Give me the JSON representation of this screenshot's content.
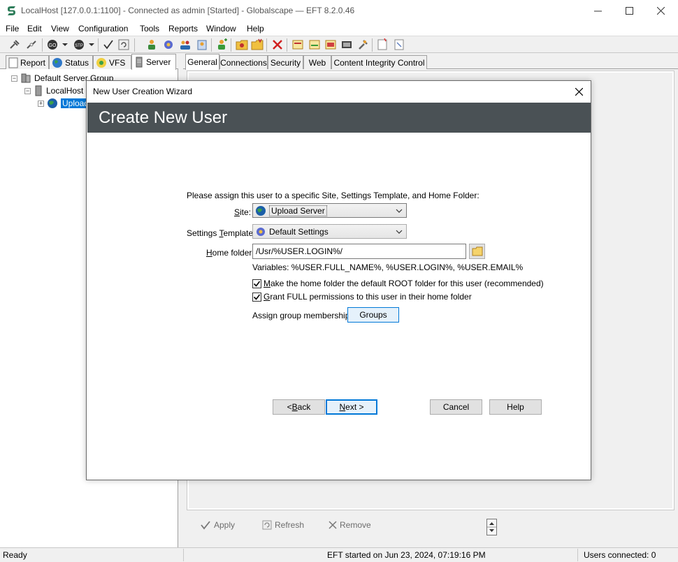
{
  "window": {
    "title": "LocalHost [127.0.0.1:1100] - Connected as admin [Started] - Globalscape — EFT 8.2.0.46"
  },
  "menu": [
    "File",
    "Edit",
    "View",
    "Configuration",
    "Tools",
    "Reports",
    "Window",
    "Help"
  ],
  "left_tabs": [
    "Report",
    "Status",
    "VFS",
    "Server"
  ],
  "tree": {
    "root": "Default Server Group",
    "server": "LocalHost",
    "site": "Upload"
  },
  "right_tabs": [
    "General",
    "Connections",
    "Security",
    "Web",
    "Content Integrity Control"
  ],
  "bottom_actions": {
    "apply": "Apply",
    "refresh": "Refresh",
    "remove": "Remove"
  },
  "status": {
    "ready": "Ready",
    "started": "EFT started on Jun 23, 2024, 07:19:16 PM",
    "users": "Users connected: 0"
  },
  "dialog": {
    "title": "New User Creation Wizard",
    "heading": "Create New User",
    "instruction": "Please assign this user to a specific Site, Settings Template, and Home Folder:",
    "site_label_key": "S",
    "site_label_rest": "ite:",
    "site_value": "Upload Server",
    "template_label_pre": "Settings ",
    "template_label_key": "T",
    "template_label_rest": "emplate:",
    "template_value": "Default Settings",
    "home_label_key": "H",
    "home_label_rest": "ome folder:",
    "home_value": "/Usr/%USER.LOGIN%/",
    "variables": "Variables: %USER.FULL_NAME%, %USER.LOGIN%, %USER.EMAIL%",
    "root_check_key": "M",
    "root_check_rest": "ake the home folder the default ROOT folder for this user (recommended)",
    "grant_check_key": "G",
    "grant_check_rest": "rant FULL permissions to this user in their home folder",
    "group_label": "Assign group membership:",
    "groups_button": "Groups",
    "back_pre": "< ",
    "back_key": "B",
    "back_rest": "ack",
    "next_key": "N",
    "next_rest": "ext >",
    "cancel_button": "Cancel",
    "help_button": "Help"
  }
}
